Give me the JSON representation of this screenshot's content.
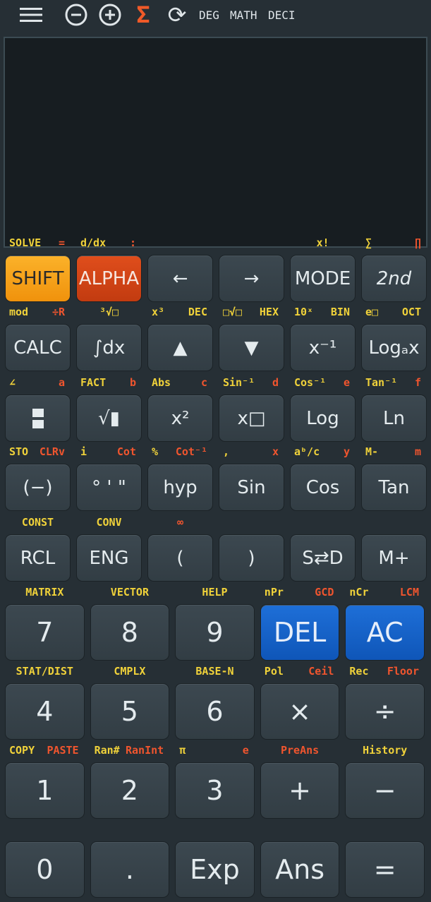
{
  "topbar": {
    "modes": [
      "DEG",
      "MATH",
      "DECI"
    ],
    "colors": {
      "sigma": "#f05a28"
    },
    "icons": [
      "menu-icon",
      "zoom-out-icon",
      "zoom-in-icon",
      "sigma-icon",
      "refresh-icon"
    ]
  },
  "rows": [
    {
      "cols": 6,
      "keys": [
        {
          "t": "SHIFT",
          "c": "shift"
        },
        {
          "t": "ALPHA",
          "c": "alpha"
        },
        {
          "t": "←"
        },
        {
          "t": "→"
        },
        {
          "t": "MODE"
        },
        {
          "t": "2nd",
          "c": "it"
        }
      ],
      "labels": [
        [
          [
            "SOLVE",
            "y"
          ],
          [
            "=",
            "r"
          ]
        ],
        [
          [
            "d/dx",
            "y"
          ],
          [
            ":",
            "r"
          ]
        ],
        [],
        [],
        [
          [
            "x!",
            "y"
          ]
        ],
        [
          [
            "∑",
            "y"
          ],
          [
            "∏",
            "r"
          ]
        ]
      ]
    },
    {
      "cols": 6,
      "keys": [
        {
          "t": "CALC"
        },
        {
          "t": "∫dx"
        },
        {
          "t": "▲"
        },
        {
          "t": "▼"
        },
        {
          "t": "x⁻¹"
        },
        {
          "t": "Logₐx"
        }
      ],
      "labels": [
        [
          [
            "mod",
            "y"
          ],
          [
            "÷R",
            "r"
          ]
        ],
        [
          [
            "³√□",
            "y"
          ]
        ],
        [
          [
            "x³",
            "y"
          ],
          [
            "DEC",
            "y"
          ]
        ],
        [
          [
            "□√□",
            "y"
          ],
          [
            "HEX",
            "y"
          ]
        ],
        [
          [
            "10ˣ",
            "y"
          ],
          [
            "BIN",
            "y"
          ]
        ],
        [
          [
            "e□",
            "y"
          ],
          [
            "OCT",
            "y"
          ]
        ]
      ]
    },
    {
      "cols": 6,
      "keys": [
        {
          "t": "",
          "c": "fracicon"
        },
        {
          "t": "√▮"
        },
        {
          "t": "x²"
        },
        {
          "t": "x□"
        },
        {
          "t": "Log"
        },
        {
          "t": "Ln"
        }
      ],
      "labels": [
        [
          [
            "∠",
            "y"
          ],
          [
            "a",
            "r"
          ]
        ],
        [
          [
            "FACT",
            "y"
          ],
          [
            "b",
            "r"
          ]
        ],
        [
          [
            "Abs",
            "y"
          ],
          [
            "c",
            "r"
          ]
        ],
        [
          [
            "Sin⁻¹",
            "y"
          ],
          [
            "d",
            "r"
          ]
        ],
        [
          [
            "Cos⁻¹",
            "y"
          ],
          [
            "e",
            "r"
          ]
        ],
        [
          [
            "Tan⁻¹",
            "y"
          ],
          [
            "f",
            "r"
          ]
        ]
      ]
    },
    {
      "cols": 6,
      "keys": [
        {
          "t": "(−)"
        },
        {
          "t": "° ' \""
        },
        {
          "t": "hyp"
        },
        {
          "t": "Sin"
        },
        {
          "t": "Cos"
        },
        {
          "t": "Tan"
        }
      ],
      "labels": [
        [
          [
            "STO",
            "y"
          ],
          [
            "CLRv",
            "r"
          ]
        ],
        [
          [
            "i",
            "y"
          ],
          [
            "Cot",
            "r"
          ]
        ],
        [
          [
            "%",
            "y"
          ],
          [
            "Cot⁻¹",
            "r"
          ]
        ],
        [
          [
            ",",
            "y"
          ],
          [
            "x",
            "r"
          ]
        ],
        [
          [
            "aᵇ/c",
            "y"
          ],
          [
            "y",
            "r"
          ]
        ],
        [
          [
            "M-",
            "y"
          ],
          [
            "m",
            "r"
          ]
        ]
      ]
    },
    {
      "cols": 6,
      "keys": [
        {
          "t": "RCL"
        },
        {
          "t": "ENG"
        },
        {
          "t": "("
        },
        {
          "t": ")"
        },
        {
          "t": "S⇄D"
        },
        {
          "t": "M+"
        }
      ],
      "labels": [
        [
          [
            "CONST",
            "y"
          ]
        ],
        [
          [
            "CONV",
            "y"
          ]
        ],
        [
          [
            "∞",
            "r"
          ]
        ],
        [],
        []
      ]
    },
    {
      "cols": 5,
      "keys": [
        {
          "t": "7"
        },
        {
          "t": "8"
        },
        {
          "t": "9"
        },
        {
          "t": "DEL",
          "c": "blue"
        },
        {
          "t": "AC",
          "c": "blue"
        }
      ],
      "labels": [
        [
          [
            "MATRIX",
            "y"
          ]
        ],
        [
          [
            "VECTOR",
            "y"
          ]
        ],
        [
          [
            "HELP",
            "y"
          ]
        ],
        [
          [
            "nPr",
            "y"
          ],
          [
            "GCD",
            "r"
          ]
        ],
        [
          [
            "nCr",
            "y"
          ],
          [
            "LCM",
            "r"
          ]
        ]
      ]
    },
    {
      "cols": 5,
      "keys": [
        {
          "t": "4"
        },
        {
          "t": "5"
        },
        {
          "t": "6"
        },
        {
          "t": "×"
        },
        {
          "t": "÷"
        }
      ],
      "labels": [
        [
          [
            "STAT/DIST",
            "y"
          ]
        ],
        [
          [
            "CMPLX",
            "y"
          ]
        ],
        [
          [
            "BASE-N",
            "y"
          ]
        ],
        [
          [
            "Pol",
            "y"
          ],
          [
            "Ceil",
            "r"
          ]
        ],
        [
          [
            "Rec",
            "y"
          ],
          [
            "Floor",
            "r"
          ]
        ]
      ]
    },
    {
      "cols": 5,
      "keys": [
        {
          "t": "1"
        },
        {
          "t": "2"
        },
        {
          "t": "3"
        },
        {
          "t": "+"
        },
        {
          "t": "−"
        }
      ],
      "labels": [
        [
          [
            "COPY",
            "y"
          ],
          [
            "PASTE",
            "r"
          ]
        ],
        [
          [
            "Ran#",
            "y"
          ],
          [
            "RanInt",
            "r"
          ]
        ],
        [
          [
            "π",
            "y"
          ],
          [
            "e",
            "r"
          ]
        ],
        [
          [
            "PreAns",
            "r"
          ]
        ],
        [
          [
            "History",
            "y"
          ]
        ]
      ]
    },
    {
      "cols": 5,
      "keys": [
        {
          "t": "0"
        },
        {
          "t": "."
        },
        {
          "t": "Exp"
        },
        {
          "t": "Ans"
        },
        {
          "t": "="
        }
      ],
      "labels": []
    }
  ]
}
